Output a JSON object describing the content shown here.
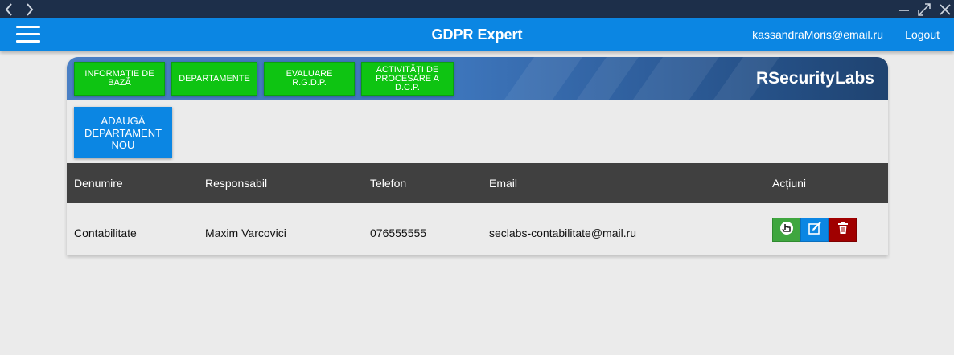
{
  "app": {
    "title": "GDPR Expert"
  },
  "header": {
    "user_email": "kassandraMoris@email.ru",
    "logout_label": "Logout"
  },
  "brand": "RSecurityLabs",
  "tabs": [
    {
      "label": "Informație de bază"
    },
    {
      "label": "Departamente"
    },
    {
      "label": "Evaluare R.G.D.P."
    },
    {
      "label": "Activități de procesare a D.C.P."
    }
  ],
  "add_button": {
    "label": "Adaugă departament nou"
  },
  "table": {
    "columns": [
      "Denumire",
      "Responsabil",
      "Telefon",
      "Email",
      "Acțiuni"
    ],
    "rows": [
      {
        "denumire": "Contabilitate",
        "responsabil": "Maxim Varcovici",
        "telefon": "076555555",
        "email": "seclabs-contabilitate@mail.ru"
      }
    ]
  },
  "icons": {
    "view": "hand-pointer-icon",
    "edit": "edit-icon",
    "delete": "trash-icon"
  },
  "colors": {
    "appbar": "#0b86e3",
    "tab_green": "#0ec412",
    "table_header": "#404040",
    "view_btn": "#3fa63f",
    "edit_btn": "#0b86e3",
    "delete_btn": "#a00000"
  }
}
